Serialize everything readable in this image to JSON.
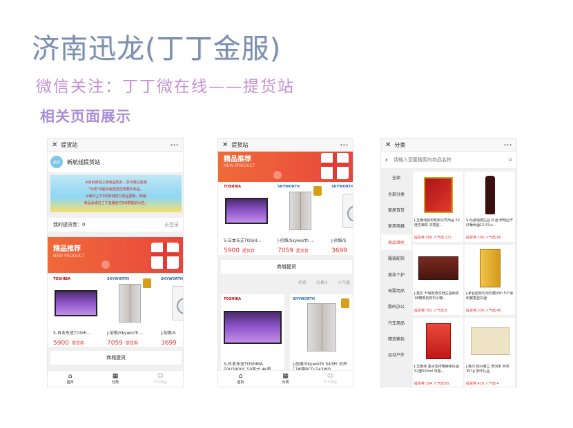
{
  "header": {
    "title": "济南迅龙(丁丁金服)",
    "subtitle": "微信关注：丁丁微在线——提货站",
    "section": "相关页面展示"
  },
  "screen1": {
    "topbar_title": "提货站",
    "close": "✕",
    "more": "···",
    "site_name": "新航线提货站",
    "logo_text": "航线",
    "notice_line1": "※目前商城上架商品较多，您可通过底端",
    "notice_line2": "\"分类\"功能快速查找您需要的商品。",
    "notice_line3": "※每日上午9时商城进行商品更新，畅销",
    "notice_line4": "商品会通过丁丁金服官方QQ群提前公告。",
    "coupon_label": "我的提货券：0",
    "coupon_login": "去登录",
    "banner_title": "精品推荐",
    "banner_sub": "NEW PRODUCT",
    "products": [
      {
        "brand": "TOSHIBA",
        "name": "S-日本东芝TOSHI...",
        "price": "5900",
        "tag": "提货券"
      },
      {
        "brand": "SKYWORTH",
        "name": "J-创维/Skyworth ...",
        "price": "7059",
        "tag": "提货券"
      },
      {
        "brand": "SKYWORTH",
        "name": "J-创维/S",
        "price": "3699",
        "tag": ""
      }
    ],
    "mall_button": "商城提货",
    "tabs": [
      {
        "icon": "⌂",
        "label": "首页"
      },
      {
        "icon": "▦",
        "label": "分类"
      },
      {
        "icon": "☺",
        "label": "个人中心"
      }
    ]
  },
  "screen2": {
    "topbar_title": "提货站",
    "close": "✕",
    "more": "···",
    "banner_title": "精品推荐",
    "banner_sub": "NEW PRODUCT",
    "products": [
      {
        "brand": "TOSHIBA",
        "name": "S-日本东芝TOSHI...",
        "price": "5900",
        "tag": "提货券"
      },
      {
        "brand": "SKYWORTH",
        "name": "J-创维/Skyworth ...",
        "price": "7059",
        "tag": "提货券"
      },
      {
        "brand": "SKYWORTH",
        "name": "J-创维/S",
        "price": "3699",
        "tag": ""
      }
    ],
    "mall_button": "商城提货",
    "sort": [
      "综合",
      "价格↕",
      "人气值"
    ],
    "big_products": [
      {
        "brand": "TOSHIBA",
        "name": "S-日本东芝TOSHIBA 50U3900C 50英寸 4K超"
      },
      {
        "brand": "SKYWORTH",
        "name": "J-创维/Skyworth 543升 对开门冰箱BCD-543WO"
      }
    ],
    "tabs": [
      {
        "icon": "⌂",
        "label": "首页"
      },
      {
        "icon": "▦",
        "label": "分类"
      },
      {
        "icon": "☺",
        "label": "个人中心"
      }
    ]
  },
  "screen3": {
    "topbar_title": "分类",
    "close": "✕",
    "more": "···",
    "back": "‹",
    "search_placeholder": "请输入您要搜索的商品名称",
    "search_icon": "⌕",
    "categories": [
      "全部",
      "全部分类",
      "家居百货",
      "家用电器",
      "食品酒水",
      "服装配饰",
      "美妆个护",
      "母婴用品",
      "数码办公",
      "汽车用品",
      "精选箱包",
      "运动户外"
    ],
    "active_category": "食品酒水",
    "items": [
      {
        "name": "J-五粮液股份有限公司出品 52度五粮陈 浓香型...",
        "meta": "提货券:586 人气值:137"
      },
      {
        "name": "S-玛歌纳德庄园 红酒 伊甸园干红葡萄酒12.5%v...",
        "meta": "提货券:105 人气值:60"
      },
      {
        "name": "J-集优 升级款尊享野生富硒茶18罐明前有机小罐...",
        "meta": "提货券:762 人气值:8"
      },
      {
        "name": "J-茅台醇浆封坛珍藏V90 53°柔和酱香型白酒",
        "meta": "提货券:339 人气值:40"
      },
      {
        "name": "J-五粮液 富贵吉祥精酿级白酒52度500ml 单瓶...",
        "meta": "提货券:184 人气值:65"
      },
      {
        "name": "J-森灵 桃月春兰 普洱茶 熟茶357g 茶叶礼品",
        "meta": "提货券:420 人气值:4"
      }
    ]
  }
}
